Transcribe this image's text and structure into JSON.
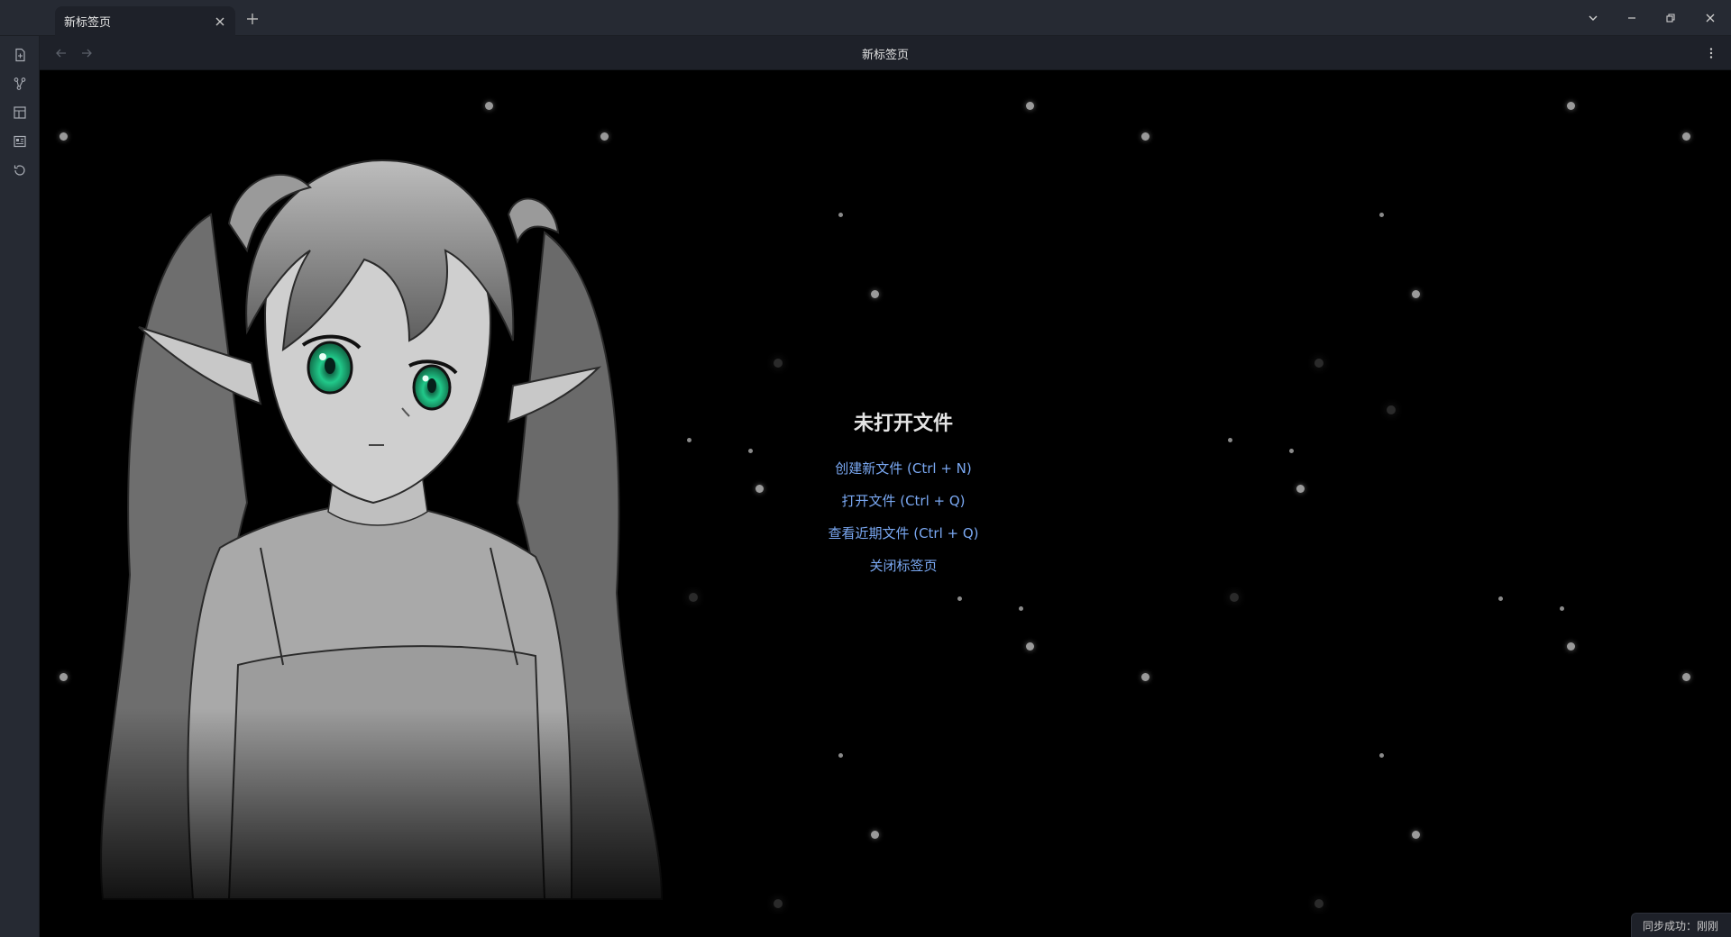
{
  "titlebar": {
    "tab_label": "新标签页",
    "close_icon": "close-icon",
    "new_tab_icon": "plus-icon",
    "window_controls": [
      "chevron-down-icon",
      "minimize-icon",
      "restore-icon",
      "close-icon"
    ]
  },
  "ribbon": {
    "items": [
      "new-note-icon",
      "graph-view-icon",
      "canvas-icon",
      "slides-icon",
      "sync-history-icon"
    ]
  },
  "viewheader": {
    "title": "新标签页",
    "back_icon": "arrow-left-icon",
    "forward_icon": "arrow-right-icon",
    "more_icon": "more-vertical-icon"
  },
  "empty_state": {
    "title": "未打开文件",
    "actions": [
      "创建新文件 (Ctrl + N)",
      "打开文件 (Ctrl + Q)",
      "查看近期文件 (Ctrl + Q)",
      "关闭标签页"
    ]
  },
  "statusbar": {
    "sync_status": "同步成功：刚刚"
  },
  "colors": {
    "accent_link": "#7aa8f2",
    "chrome": "#262a33",
    "background": "#000000",
    "eye": "#21c98a"
  }
}
